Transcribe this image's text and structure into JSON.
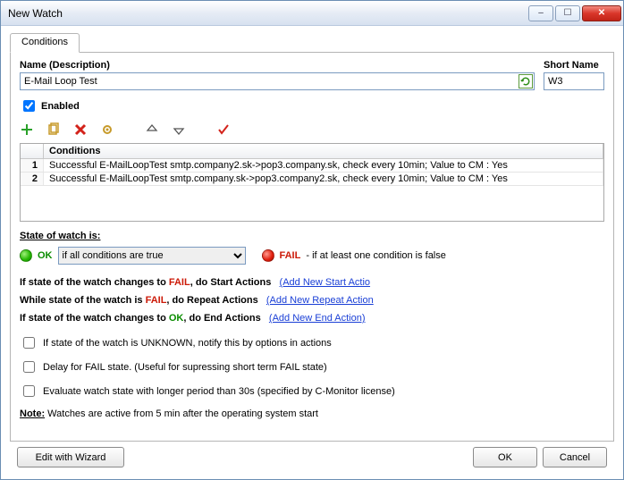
{
  "window": {
    "title": "New Watch",
    "min_label": "–",
    "max_label": "☐",
    "close_label": "✕"
  },
  "tabs": {
    "conditions": "Conditions"
  },
  "form": {
    "name_label": "Name (Description)",
    "name_value": "E-Mail Loop Test",
    "shortname_label": "Short Name",
    "shortname_value": "W3",
    "enabled_label": "Enabled",
    "enabled_checked": true
  },
  "conditions": {
    "header_num": "",
    "header_text": "Conditions",
    "rows": [
      {
        "n": "1",
        "text": "Successful E-MailLoopTest smtp.company2.sk->pop3.company.sk, check every 10min; Value to CM : Yes"
      },
      {
        "n": "2",
        "text": "Successful E-MailLoopTest smtp.company.sk->pop3.company2.sk, check every 10min; Value to CM : Yes"
      }
    ]
  },
  "state": {
    "title": "State of watch is:",
    "ok": "OK",
    "fail": "FAIL",
    "select_value": "if all conditions are true",
    "fail_tail": " - if at least one condition is false"
  },
  "actions": {
    "l1_pre": "If state of the watch changes to ",
    "l1_fail": "FAIL",
    "l1_mid": ", do ",
    "l1_act": "Start Actions",
    "l1_link": "(Add New Start Actio",
    "l2_pre": "While state of the watch is ",
    "l2_fail": "FAIL",
    "l2_mid": ", do ",
    "l2_act": "Repeat Actions",
    "l2_link": "(Add New Repeat Action",
    "l3_pre": "If state of the watch changes to ",
    "l3_ok": "OK",
    "l3_mid": ", do ",
    "l3_act": "End Actions",
    "l3_link": "(Add New End Action)"
  },
  "checks": {
    "c1": "If state of the watch is UNKNOWN, notify this by options in actions",
    "c2": "Delay for FAIL state. (Useful for supressing short term FAIL state)",
    "c3": "Evaluate watch state with longer period than 30s (specified by C-Monitor license)"
  },
  "note": {
    "label": "Note:",
    "text": " Watches are active from 5 min after the operating system start"
  },
  "buttons": {
    "wizard": "Edit with Wizard",
    "ok": "OK",
    "cancel": "Cancel"
  }
}
